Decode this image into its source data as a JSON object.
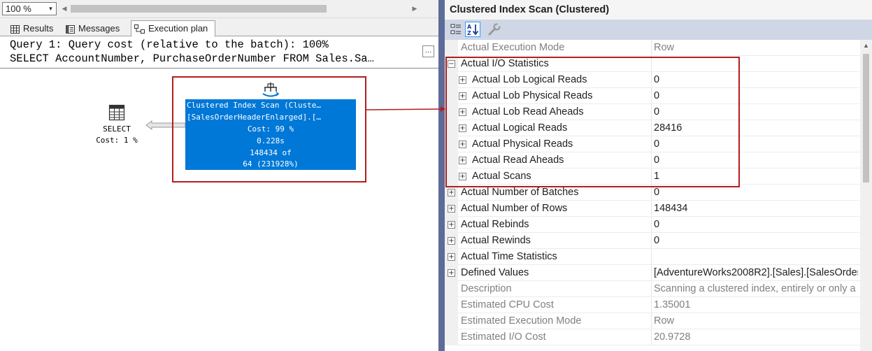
{
  "zoom": {
    "value": "100 %"
  },
  "tabs": [
    {
      "label": "Results",
      "icon": "grid-icon"
    },
    {
      "label": "Messages",
      "icon": "messages-icon"
    },
    {
      "label": "Execution plan",
      "icon": "execution-plan-icon"
    }
  ],
  "query": {
    "line1": "Query 1: Query cost (relative to the batch): 100%",
    "line2": "SELECT AccountNumber, PurchaseOrderNumber FROM Sales.Sa…",
    "more_label": "…"
  },
  "plan": {
    "select_node": {
      "label": "SELECT",
      "cost": "Cost: 1 %"
    },
    "scan_node": {
      "lines": [
        "Clustered Index Scan (Cluste…",
        "[SalesOrderHeaderEnlarged].[…",
        "Cost: 99 %",
        "0.228s",
        "148434 of",
        "64 (231928%)"
      ]
    }
  },
  "properties": {
    "title": "Clustered Index Scan (Clustered)",
    "rows": [
      {
        "name": "Actual Execution Mode",
        "value": "Row",
        "level": 0,
        "expander": "",
        "readonly": true
      },
      {
        "name": "Actual I/O Statistics",
        "value": "",
        "level": 0,
        "expander": "−",
        "readonly": false
      },
      {
        "name": "Actual Lob Logical Reads",
        "value": "0",
        "level": 1,
        "expander": "+",
        "readonly": false
      },
      {
        "name": "Actual Lob Physical Reads",
        "value": "0",
        "level": 1,
        "expander": "+",
        "readonly": false
      },
      {
        "name": "Actual Lob Read Aheads",
        "value": "0",
        "level": 1,
        "expander": "+",
        "readonly": false
      },
      {
        "name": "Actual Logical Reads",
        "value": "28416",
        "level": 1,
        "expander": "+",
        "readonly": false
      },
      {
        "name": "Actual Physical Reads",
        "value": "0",
        "level": 1,
        "expander": "+",
        "readonly": false
      },
      {
        "name": "Actual Read Aheads",
        "value": "0",
        "level": 1,
        "expander": "+",
        "readonly": false
      },
      {
        "name": "Actual Scans",
        "value": "1",
        "level": 1,
        "expander": "+",
        "readonly": false
      },
      {
        "name": "Actual Number of Batches",
        "value": "0",
        "level": 0,
        "expander": "+",
        "readonly": false
      },
      {
        "name": "Actual Number of Rows",
        "value": "148434",
        "level": 0,
        "expander": "+",
        "readonly": false
      },
      {
        "name": "Actual Rebinds",
        "value": "0",
        "level": 0,
        "expander": "+",
        "readonly": false
      },
      {
        "name": "Actual Rewinds",
        "value": "0",
        "level": 0,
        "expander": "+",
        "readonly": false
      },
      {
        "name": "Actual Time Statistics",
        "value": "",
        "level": 0,
        "expander": "+",
        "readonly": false
      },
      {
        "name": "Defined Values",
        "value": "[AdventureWorks2008R2].[Sales].[SalesOrder",
        "level": 0,
        "expander": "+",
        "readonly": false
      },
      {
        "name": "Description",
        "value": "Scanning a clustered index, entirely or only a",
        "level": 0,
        "expander": "",
        "readonly": true
      },
      {
        "name": "Estimated CPU Cost",
        "value": "1.35001",
        "level": 0,
        "expander": "",
        "readonly": true
      },
      {
        "name": "Estimated Execution Mode",
        "value": "Row",
        "level": 0,
        "expander": "",
        "readonly": true
      },
      {
        "name": "Estimated I/O Cost",
        "value": "20.9728",
        "level": 0,
        "expander": "",
        "readonly": true
      }
    ]
  },
  "colors": {
    "accent": "#0078d7",
    "highlight_border": "#b21e1e",
    "splitter": "#5d6b99",
    "toolbar": "#cfd6e5"
  }
}
